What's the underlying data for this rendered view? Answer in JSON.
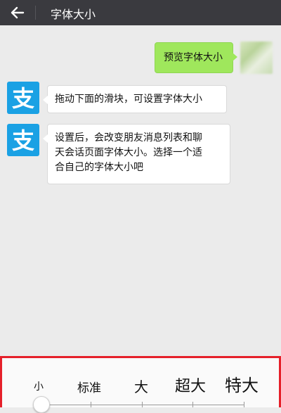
{
  "header": {
    "title": "字体大小",
    "back_icon": "arrow-left-icon"
  },
  "messages": [
    {
      "from": "me",
      "text": "预览字体大小"
    },
    {
      "from": "bot",
      "text": "拖动下面的滑块，可设置字体大小"
    },
    {
      "from": "bot",
      "lines": [
        "设置后，会改变朋友消息列表和聊",
        "天会话页面字体大小。选择一个适",
        "合自己的字体大小吧"
      ]
    }
  ],
  "bot_avatar_glyph": "支",
  "font_size_slider": {
    "labels": [
      "小",
      "标准",
      "大",
      "超大",
      "特大"
    ],
    "selected_index": 0
  },
  "colors": {
    "topbar": "#3a3a3f",
    "my_bubble": "#9fe75c",
    "bot_avatar": "#1aa1e4",
    "highlight_border": "#e5202a"
  }
}
